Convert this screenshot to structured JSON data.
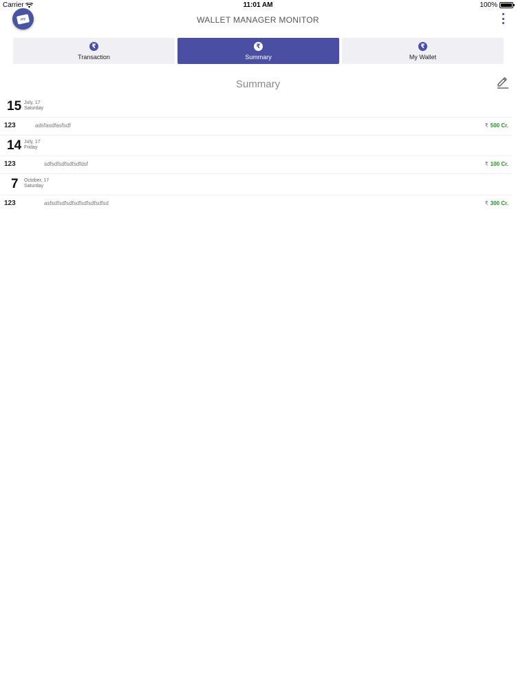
{
  "status_bar": {
    "carrier": "Carrier",
    "time": "11:01 AM",
    "battery": "100%"
  },
  "header": {
    "logo_text": "my",
    "title": "WALLET MANAGER MONITOR"
  },
  "tabs": [
    {
      "label": "Transaction",
      "icon": "₹",
      "active": false
    },
    {
      "label": "Summary",
      "icon": "₹",
      "active": true
    },
    {
      "label": "My Wallet",
      "icon": "₹",
      "active": false
    }
  ],
  "section": {
    "title": "Summary"
  },
  "groups": [
    {
      "day": "15",
      "month_year": "July, 17",
      "weekday": "Saturday",
      "transactions": [
        {
          "id": "123",
          "description": "adsfasdfasfsdf",
          "currency": "₹",
          "amount": "500 Cr."
        }
      ]
    },
    {
      "day": "14",
      "month_year": "July, 17",
      "weekday": "Friday",
      "transactions": [
        {
          "id": "123",
          "description": "sdfsdfsdfsdfsdfdsf",
          "currency": "₹",
          "amount": "100 Cr."
        }
      ]
    },
    {
      "day": "7",
      "month_year": "October, 17",
      "weekday": "Saturday",
      "transactions": [
        {
          "id": "123",
          "description": "asfsdfsdfsdfsdfsdfsdfsdfsd",
          "currency": "₹",
          "amount": "300 Cr."
        }
      ]
    }
  ],
  "colors": {
    "brand": "#4a4fa3",
    "credit": "#2e8b2e"
  }
}
